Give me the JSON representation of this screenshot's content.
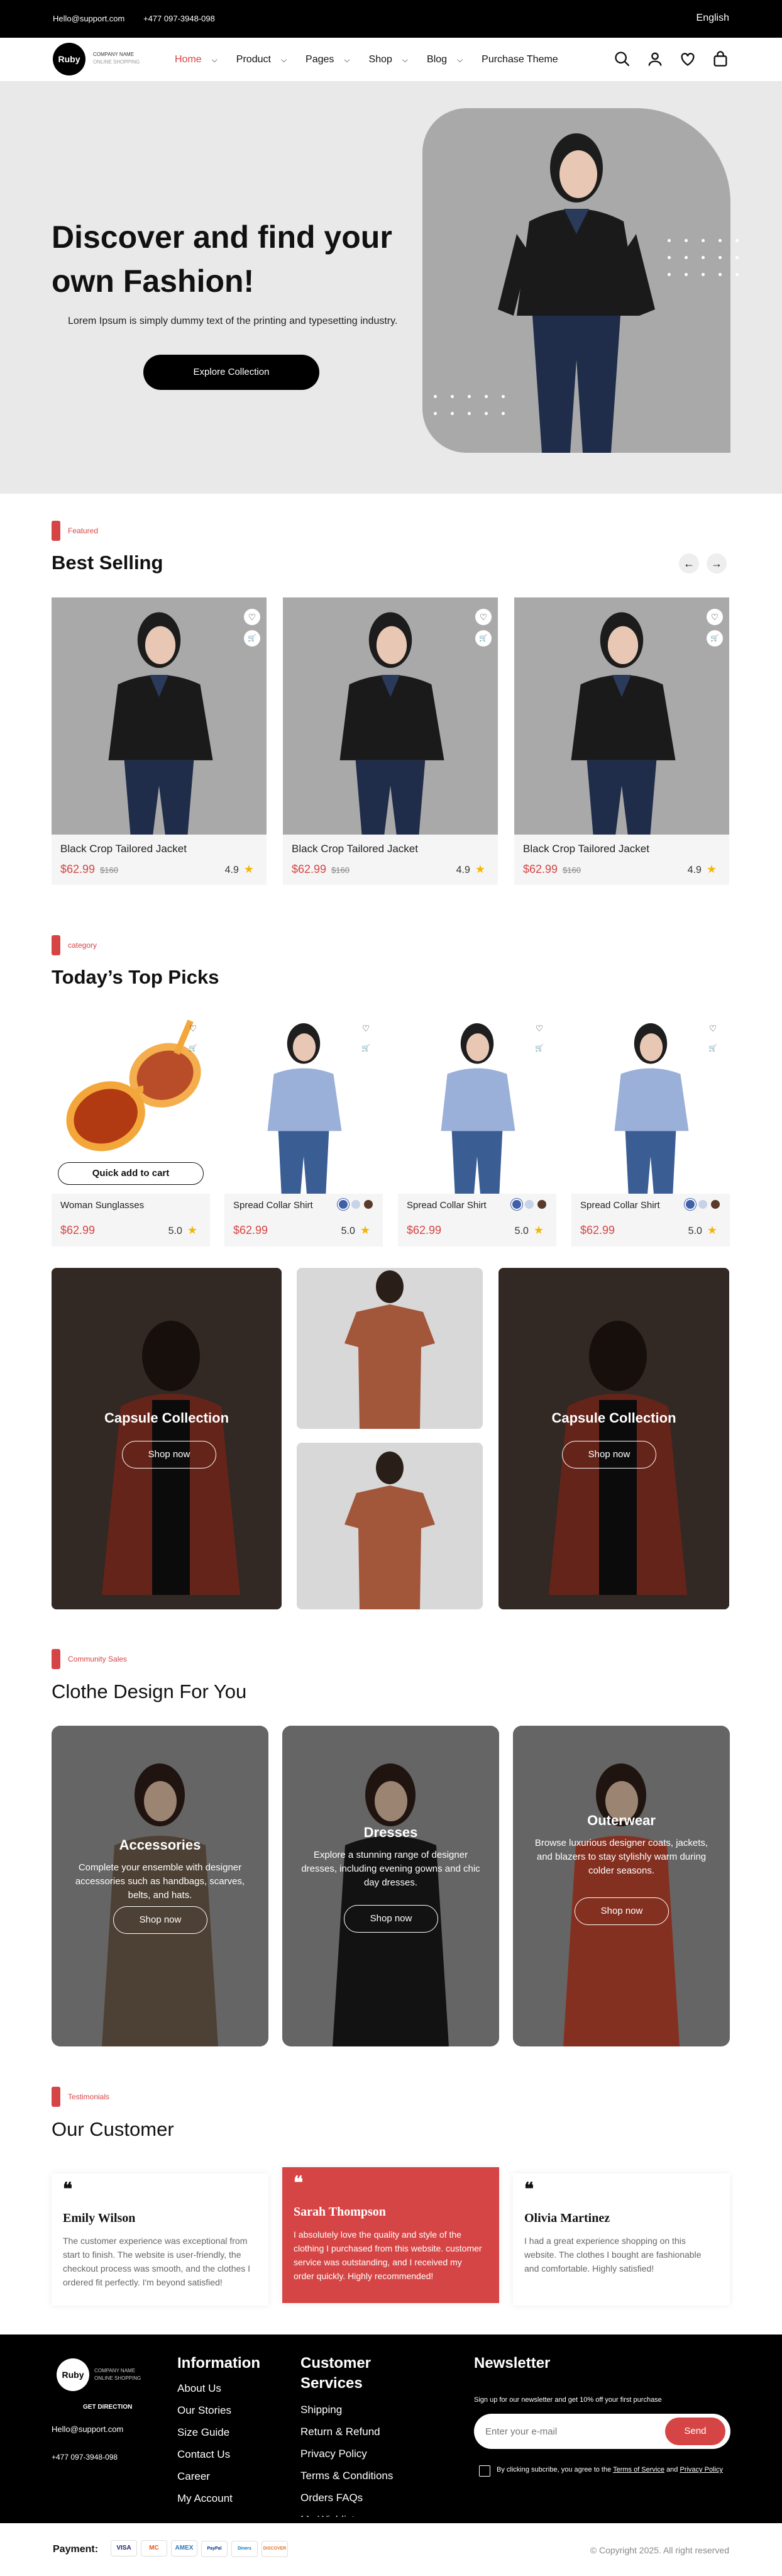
{
  "topbar": {
    "email": "Hello@support.com",
    "phone": "+477 097-3948-098",
    "language": "English"
  },
  "brand": {
    "logo_text": "Ruby",
    "company_line1": "COMPANY NAME",
    "company_line2": "ONLINE SHOPPING"
  },
  "nav": {
    "items": [
      {
        "label": "Home",
        "active": true,
        "dropdown": true
      },
      {
        "label": "Product",
        "active": false,
        "dropdown": true
      },
      {
        "label": "Pages",
        "active": false,
        "dropdown": true
      },
      {
        "label": "Shop",
        "active": false,
        "dropdown": true
      },
      {
        "label": "Blog",
        "active": false,
        "dropdown": true
      },
      {
        "label": "Purchase Theme",
        "active": false,
        "dropdown": false
      }
    ]
  },
  "icons": [
    "search-icon",
    "user-icon",
    "heart-icon",
    "bag-icon"
  ],
  "hero": {
    "title": "Discover and find your own Fashion!",
    "subtitle": "Lorem Ipsum is simply dummy text of the printing and typesetting industry.",
    "cta": "Explore Collection"
  },
  "best_selling": {
    "tag": "Featured",
    "title": "Best Selling",
    "products": [
      {
        "name": "Black Crop Tailored Jacket",
        "price": "$62.99",
        "old_price": "$160",
        "rating": "4.9"
      },
      {
        "name": "Black Crop Tailored Jacket",
        "price": "$62.99",
        "old_price": "$160",
        "rating": "4.9"
      },
      {
        "name": "Black Crop Tailored Jacket",
        "price": "$62.99",
        "old_price": "$160",
        "rating": "4.9"
      }
    ]
  },
  "top_picks": {
    "tag": "category",
    "title": "Today’s Top Picks",
    "quick_add": "Quick add to cart",
    "products": [
      {
        "name": "Woman Sunglasses",
        "price": "$62.99",
        "rating": "5.0"
      },
      {
        "name": "Spread Collar Shirt",
        "price": "$62.99",
        "rating": "5.0"
      },
      {
        "name": "Spread Collar Shirt",
        "price": "$62.99",
        "rating": "5.0"
      },
      {
        "name": "Spread Collar Shirt",
        "price": "$62.99",
        "rating": "5.0"
      }
    ],
    "swatches": [
      "#3f5fa8",
      "#c8d2e8",
      "#5a3a2a"
    ]
  },
  "collections": {
    "left": {
      "title": "Capsule Collection",
      "button": "Shop now"
    },
    "right": {
      "title": "Capsule Collection",
      "button": "Shop now"
    }
  },
  "community": {
    "tag": "Community Sales",
    "title": "Clothe Design For You",
    "cards": [
      {
        "title": "Accessories",
        "desc": "Complete your ensemble with designer accessories such as handbags, scarves, belts, and hats.",
        "button": "Shop now"
      },
      {
        "title": "Dresses",
        "desc": "Explore a stunning range of designer dresses, including evening gowns and chic day dresses.",
        "button": "Shop now"
      },
      {
        "title": "Outerwear",
        "desc": "Browse luxurious designer coats, jackets, and blazers to stay stylishly warm during colder seasons.",
        "button": "Shop now"
      }
    ]
  },
  "testimonials": {
    "tag": "Testimonials",
    "title": "Our Customer",
    "items": [
      {
        "name": "Emily Wilson",
        "text": "The customer experience was exceptional from start to finish. The website is user-friendly, the checkout process was smooth, and the clothes I ordered fit perfectly. I'm beyond satisfied!"
      },
      {
        "name": "Sarah Thompson",
        "text": "I absolutely love the quality and style of the clothing I purchased from this website. customer service was outstanding, and I received my order quickly. Highly recommended!"
      },
      {
        "name": "Olivia Martinez",
        "text": "I had a great experience shopping on this website. The clothes I bought are fashionable and comfortable. Highly satisfied!"
      }
    ]
  },
  "footer": {
    "get_direction": "GET DIRECTION",
    "email": "Hello@support.com",
    "phone": "+477 097-3948-098",
    "information": {
      "title": "Information",
      "links": [
        "About Us",
        "Our Stories",
        "Size Guide",
        "Contact Us",
        "Career",
        "My Account"
      ]
    },
    "customer_services": {
      "title": "Customer Services",
      "links": [
        "Shipping",
        "Return & Refund",
        "Privacy Policy",
        "Terms & Conditions",
        "Orders FAQs",
        "My Wishlist"
      ]
    },
    "newsletter": {
      "title": "Newsletter",
      "text": "Sign up for our newsletter and get 10% off your first purchase",
      "placeholder": "Enter your e-mail",
      "button": "Send",
      "consent_prefix": "By clicking subcribe, you agree to the",
      "terms": "Terms of Service",
      "and": "and",
      "privacy": "Privacy Policy"
    }
  },
  "payment": {
    "label": "Payment:",
    "methods": [
      "VISA",
      "MC",
      "AMEX",
      "PayPal",
      "Diners",
      "DISCOVER"
    ],
    "copyright": "© Copyright 2025. All right reserved"
  },
  "colors": {
    "accent": "#d64545",
    "dark": "#000000",
    "panel": "#e9e9e9"
  }
}
